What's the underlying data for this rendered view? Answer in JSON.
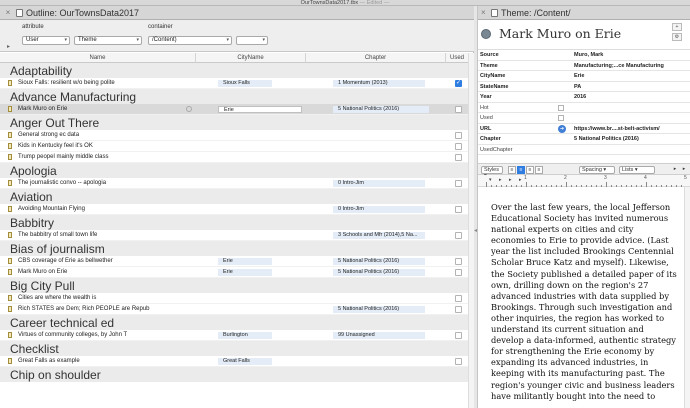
{
  "window": {
    "title": "OurTownsData2017.tbx",
    "edited": "— Edited —"
  },
  "left": {
    "tab_title": "Outline: OurTownsData2017",
    "toolbar": {
      "attribute_label": "attribute",
      "container_label": "container",
      "attribute_value": "User",
      "attribute2_value": "Theme",
      "container_value": "/Content)",
      "container2_value": ""
    },
    "columns": {
      "name": "Name",
      "city": "CityName",
      "chapter": "Chapter",
      "used": "Used"
    },
    "rows": [
      {
        "type": "group",
        "title": "Adaptability"
      },
      {
        "type": "item",
        "name": "Sioux Falls: resilient w/o being polite",
        "city": "Sioux Falls",
        "chapter": "1 Momentum (2013)",
        "used": true
      },
      {
        "type": "group",
        "title": "Advance Manufacturing"
      },
      {
        "type": "item",
        "name": "Mark Muro on Erie",
        "city": "Erie",
        "chapter": "5 National Politics (2016)",
        "used": false,
        "selected": true
      },
      {
        "type": "group",
        "title": "Anger Out There"
      },
      {
        "type": "item",
        "name": "General strong ec data",
        "city": "",
        "chapter": "",
        "used": false
      },
      {
        "type": "item",
        "name": "Kids in Kentucky feel it's OK",
        "city": "",
        "chapter": "",
        "used": false
      },
      {
        "type": "item",
        "name": "Trump peopel mainly middle class",
        "city": "",
        "chapter": "",
        "used": false
      },
      {
        "type": "group",
        "title": "Apologia"
      },
      {
        "type": "item",
        "name": "The journalistic convo -- apologia",
        "city": "",
        "chapter": "0 Intro-Jim",
        "used": false
      },
      {
        "type": "group",
        "title": "Aviation"
      },
      {
        "type": "item",
        "name": "Avoiding Mountain Flying",
        "city": "",
        "chapter": "0 Intro-Jim",
        "used": false
      },
      {
        "type": "group",
        "title": "Babbitry"
      },
      {
        "type": "item",
        "name": "The babbitry of small town life",
        "city": "",
        "chapter": "3 Schools and Mfr (2014),5 Na...",
        "used": false
      },
      {
        "type": "group",
        "title": "Bias of journalism"
      },
      {
        "type": "item",
        "name": "CBS coverage of Erie as bellwether",
        "city": "Erie",
        "chapter": "5 National Politics (2016)",
        "used": false
      },
      {
        "type": "item",
        "name": "Mark Muro on Erie",
        "city": "Erie",
        "chapter": "5 National Politics (2016)",
        "used": false
      },
      {
        "type": "group",
        "title": "Big City Pull"
      },
      {
        "type": "item",
        "name": "Cities are where the wealth is",
        "city": "",
        "chapter": "",
        "used": false
      },
      {
        "type": "item",
        "name": "Rich STATES are Dem; Rich PEOPLE are Repub",
        "city": "",
        "chapter": "5 National Politics (2016)",
        "used": false
      },
      {
        "type": "group",
        "title": "Career technical ed"
      },
      {
        "type": "item",
        "name": "Virtues of community colleges, by John T",
        "city": "Burlington",
        "chapter": "99 Unassigned",
        "used": false
      },
      {
        "type": "group",
        "title": "Checklist"
      },
      {
        "type": "item",
        "name": "Great Falls as example",
        "city": "Great Falls",
        "chapter": "",
        "used": false
      },
      {
        "type": "group",
        "title": "Chip on shoulder"
      }
    ]
  },
  "right": {
    "tab_title": "Theme: /Content/",
    "note_title": "Mark Muro on Erie",
    "side_buttons": [
      "+",
      "⚙"
    ],
    "attributes": [
      {
        "key": "Source",
        "value": "Muro, Mark",
        "kind": "text",
        "bold": true
      },
      {
        "key": "Theme",
        "value": "Manufacturing;...ce Manufacturing",
        "kind": "text",
        "bold": true
      },
      {
        "key": "CityName",
        "value": "Erie",
        "kind": "text",
        "bold": true
      },
      {
        "key": "StateName",
        "value": "PA",
        "kind": "text",
        "bold": true
      },
      {
        "key": "Year",
        "value": "2016",
        "kind": "text",
        "bold": true
      },
      {
        "key": "Hot",
        "value": "",
        "kind": "check",
        "bold": false
      },
      {
        "key": "Used",
        "value": "",
        "kind": "check",
        "bold": false
      },
      {
        "key": "URL",
        "value": "https://www.br....st-belt-activism/",
        "kind": "url",
        "bold": true
      },
      {
        "key": "Chapter",
        "value": "5 National Politics (2016)",
        "kind": "text",
        "bold": true
      },
      {
        "key": "UsedChapter",
        "value": "",
        "kind": "text",
        "bold": false
      }
    ],
    "format_bar": {
      "styles": "Styles",
      "spacing": "Spacing",
      "lists": "Lists"
    },
    "ruler_numbers": [
      "1",
      "2",
      "3",
      "4",
      "5"
    ],
    "body_text": "Over the last few years, the local Jefferson Educational Society has invited numerous national experts on cities and city economies to Erie to provide advice. (Last year the list included Brookings Centennial Scholar Bruce Katz and myself). Likewise, the Society published a detailed paper of its own, drilling down on the region's 27 advanced industries with data supplied by Brookings. Through such investigation and other inquiries, the region has worked to understand its current situation and develop a data-informed, authentic strategy for strengthening the Erie economy by expanding its advanced industries, in keeping with its manufacturing past. The region's younger civic and business leaders have militantly bought into the need to"
  }
}
